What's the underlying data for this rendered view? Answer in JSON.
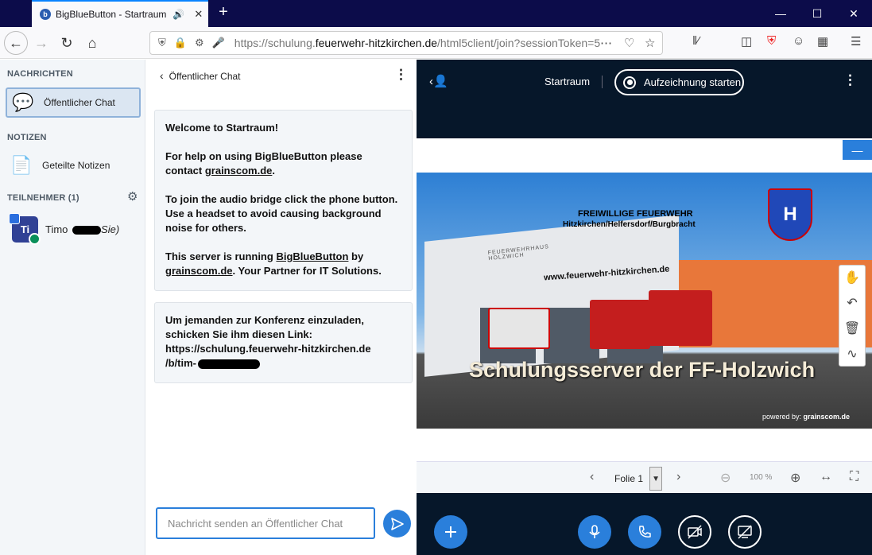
{
  "browser": {
    "tab_title": "BigBlueButton - Startraum",
    "favicon_letter": "b",
    "url_domain_prefix": "https://schulung.",
    "url_domain": "feuerwehr-hitzkirchen.de",
    "url_path": "/html5client/join?sessionToken=5"
  },
  "userlist": {
    "messages_header": "NACHRICHTEN",
    "public_chat_label": "Öffentlicher Chat",
    "notes_header": "NOTIZEN",
    "shared_notes_label": "Geteilte Notizen",
    "participants_header": "TEILNEHMER (1)",
    "user": {
      "initials": "Ti",
      "name": "Timo",
      "suffix": "Sie)"
    }
  },
  "chat": {
    "header_title": "Öffentlicher Chat",
    "welcome": {
      "line1_prefix": "Welcome to ",
      "line1_room": "Startraum",
      "line1_suffix": "!",
      "help_text": "For help on using BigBlueButton please contact ",
      "help_link": "grainscom.de",
      "help_end": ".",
      "audio_text": "To join the audio bridge click the phone button. Use a headset to avoid causing background noise for others.",
      "server_prefix": "This server is running ",
      "server_link1": "BigBlueButton",
      "server_mid": " by ",
      "server_link2": "grainscom.de",
      "server_suffix": ". Your Partner for IT Solutions."
    },
    "invite": {
      "text": "Um jemanden zur Konferenz einzuladen, schicken Sie ihm diesen Link:",
      "link_part1": "https://schulung.feuerwehr-hitzkirchen.de",
      "link_part2": "/b/tim-"
    },
    "input_placeholder": "Nachricht senden an Öffentlicher Chat"
  },
  "main": {
    "meeting_name": "Startraum",
    "record_label": "Aufzeichnung starten",
    "slide": {
      "org_line1": "FREIWILLIGE FEUERWEHR",
      "org_line2": "Hitzkirchen/Helfersdorf/Burgbracht",
      "website": "www.feuerwehr-hitzkirchen.de",
      "building_sign": "FEUERWEHRHAUS HOLZWICH",
      "crest_letter": "H",
      "headline": "Schulungsserver der FF-Holzwich",
      "powered_prefix": "powered by: ",
      "powered_brand": "grainscom.de"
    },
    "slide_label": "Folie 1",
    "zoom_level": "100 %"
  },
  "colors": {
    "accent": "#2a7fdb",
    "dark_bg": "#06172a",
    "tabbar": "#0c0c4a"
  }
}
